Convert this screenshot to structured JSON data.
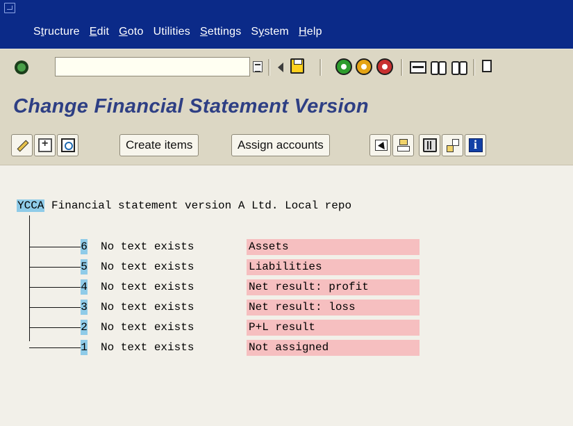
{
  "menubar": {
    "items": [
      {
        "label": "Structure",
        "mnemonic_index": 1
      },
      {
        "label": "Edit",
        "mnemonic_index": 0
      },
      {
        "label": "Goto",
        "mnemonic_index": 0
      },
      {
        "label": "Utilities",
        "mnemonic_index": -1
      },
      {
        "label": "Settings",
        "mnemonic_index": 0
      },
      {
        "label": "System",
        "mnemonic_index": 1
      },
      {
        "label": "Help",
        "mnemonic_index": 0
      }
    ]
  },
  "toolbar": {
    "command_field_value": "",
    "icons": [
      "enter-icon",
      "dropdown-icon",
      "back-arrow-icon",
      "save-icon",
      "back-icon",
      "exit-icon",
      "cancel-icon",
      "print-icon",
      "find-icon",
      "find-next-icon",
      "first-page-icon"
    ]
  },
  "title": "Change Financial Statement Version",
  "app_toolbar": {
    "create_items_label": "Create items",
    "assign_accounts_label": "Assign accounts"
  },
  "tree": {
    "root": {
      "key": "YCCA",
      "text": "Financial statement version A Ltd. Local repo"
    },
    "nodes": [
      {
        "num": "6",
        "status": "No text exists",
        "description": "Assets"
      },
      {
        "num": "5",
        "status": "No text exists",
        "description": "Liabilities"
      },
      {
        "num": "4",
        "status": "No text exists",
        "description": "Net result: profit"
      },
      {
        "num": "3",
        "status": "No text exists",
        "description": "Net result: loss"
      },
      {
        "num": "2",
        "status": "No text exists",
        "description": "P+L result"
      },
      {
        "num": "1",
        "status": "No text exists",
        "description": "Not assigned"
      }
    ]
  },
  "colors": {
    "menubar_bg": "#0b2a88",
    "toolbar_bg": "#dcd7c4",
    "title_color": "#2e3f84",
    "node_highlight": "#8fcbe8",
    "description_bg": "#f6bfc0"
  }
}
